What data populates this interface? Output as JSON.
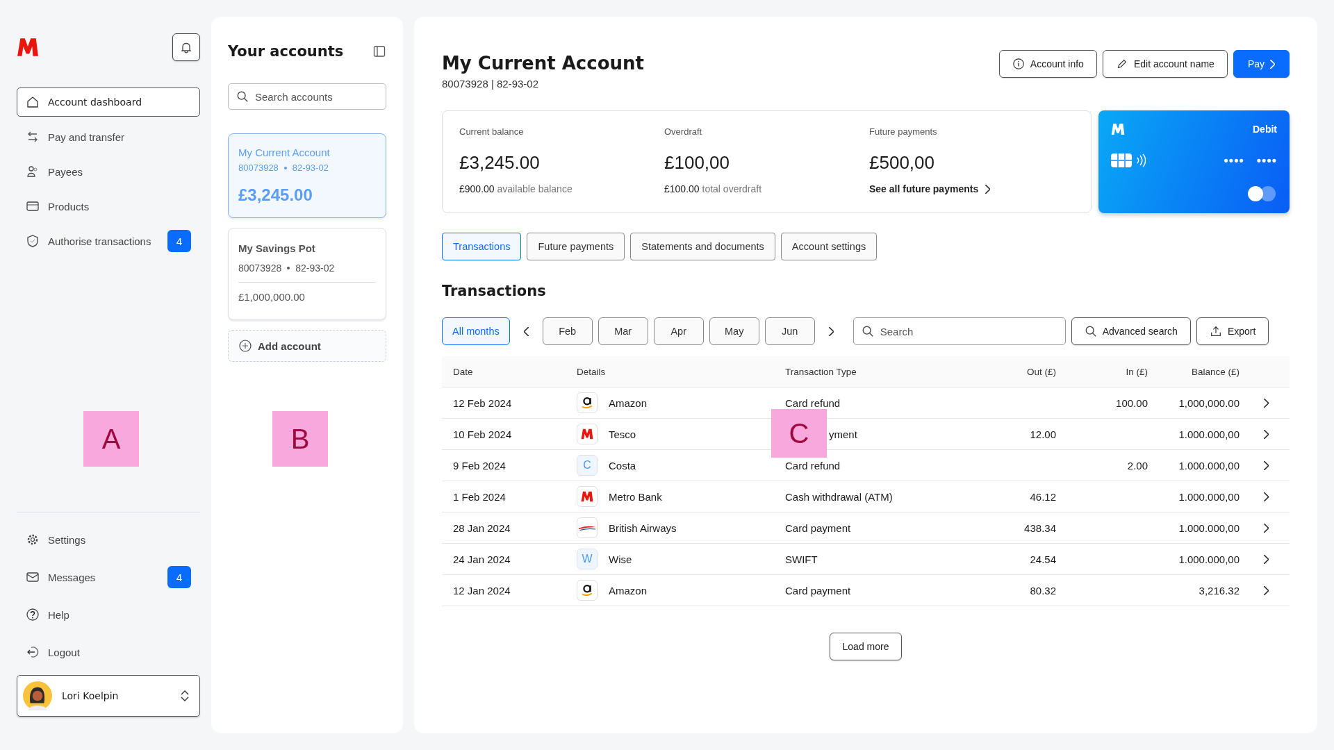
{
  "sidebar": {
    "nav": [
      {
        "label": "Account dashboard",
        "selected": true
      },
      {
        "label": "Pay and transfer",
        "selected": false
      },
      {
        "label": "Payees",
        "selected": false
      },
      {
        "label": "Products",
        "selected": false
      },
      {
        "label": "Authorise transactions",
        "selected": false,
        "badge": "4"
      }
    ],
    "bottom": [
      {
        "label": "Settings"
      },
      {
        "label": "Messages",
        "badge": "4"
      },
      {
        "label": "Help"
      },
      {
        "label": "Logout"
      }
    ],
    "user": {
      "name": "Lori Koelpin"
    }
  },
  "accounts": {
    "title": "Your accounts",
    "search": {
      "placeholder": "Search accounts"
    },
    "items": [
      {
        "name": "My Current Account",
        "number": "80073928",
        "sort_code": "82-93-02",
        "balance": "£3,245.00",
        "selected": true
      },
      {
        "name": "My Savings Pot",
        "number": "80073928",
        "sort_code": "82-93-02",
        "balance": "£1,000,000.00",
        "selected": false
      }
    ],
    "add_label": "Add account"
  },
  "main": {
    "title": "My Current Account",
    "subtitle": "80073928 | 82-93-02",
    "actions": [
      {
        "label": "Account info",
        "kind": "info"
      },
      {
        "label": "Edit account name",
        "kind": "edit"
      },
      {
        "label": "Pay",
        "kind": "primary"
      }
    ],
    "summary": [
      {
        "label": "Current balance",
        "amount": "£3,245.00",
        "note_value": "£900.00",
        "note_text": "available balance"
      },
      {
        "label": "Overdraft",
        "amount": "£100,00",
        "note_value": "£100.00",
        "note_text": "total overdraft"
      },
      {
        "label": "Future payments",
        "amount": "£500,00",
        "link": "See all future payments"
      }
    ],
    "card": {
      "type": "Debit",
      "digits": [
        "••••",
        "••••"
      ]
    },
    "tabs": [
      {
        "label": "Transactions",
        "selected": true
      },
      {
        "label": "Future payments",
        "selected": false
      },
      {
        "label": "Statements and documents",
        "selected": false
      },
      {
        "label": "Account settings",
        "selected": false
      }
    ],
    "section_title": "Transactions",
    "months": [
      {
        "label": "All months",
        "selected": true
      },
      {
        "label": "Feb",
        "selected": false
      },
      {
        "label": "Mar",
        "selected": false
      },
      {
        "label": "Apr",
        "selected": false
      },
      {
        "label": "May",
        "selected": false
      },
      {
        "label": "Jun",
        "selected": false
      }
    ],
    "search": {
      "placeholder": "Search"
    },
    "tools": [
      "Advanced search",
      "Export"
    ],
    "table": {
      "columns": [
        "Date",
        "Details",
        "Transaction Type",
        "Out (£)",
        "In (£)",
        "Balance (£)"
      ],
      "rows": [
        {
          "date": "12 Feb 2024",
          "kind": "smile",
          "details": "Amazon",
          "type": "Card refund",
          "out": "",
          "in": "100.00",
          "balance": "1,000,000.00"
        },
        {
          "date": "10 Feb 2024",
          "kind": "m",
          "details": "Tesco",
          "type": "yment",
          "covered": true,
          "out": "12.00",
          "in": "",
          "balance": "1.000.000,00"
        },
        {
          "date": "9 Feb 2024",
          "kind": "letter",
          "logo_text": "C",
          "details": "Costa",
          "type": "Card refund",
          "out": "",
          "in": "2.00",
          "balance": "1.000.000,00"
        },
        {
          "date": "1 Feb 2024",
          "kind": "m",
          "details": "Metro Bank",
          "type": "Cash withdrawal (ATM)",
          "out": "46.12",
          "in": "",
          "balance": "1.000.000,00"
        },
        {
          "date": "28 Jan 2024",
          "kind": "ribbon",
          "details": "British Airways",
          "type": "Card payment",
          "out": "438.34",
          "in": "",
          "balance": "1.000.000,00"
        },
        {
          "date": "24 Jan 2024",
          "kind": "letter",
          "logo_text": "W",
          "details": "Wise",
          "type": "SWIFT",
          "out": "24.54",
          "in": "",
          "balance": "1.000.000,00"
        },
        {
          "date": "12 Jan 2024",
          "kind": "smile",
          "details": "Amazon",
          "type": "Card payment",
          "out": "80.32",
          "in": "",
          "balance": "3,216.32"
        }
      ]
    },
    "load_more": "Load more"
  },
  "markers": [
    {
      "label": "A"
    },
    {
      "label": "B"
    },
    {
      "label": "C"
    }
  ]
}
